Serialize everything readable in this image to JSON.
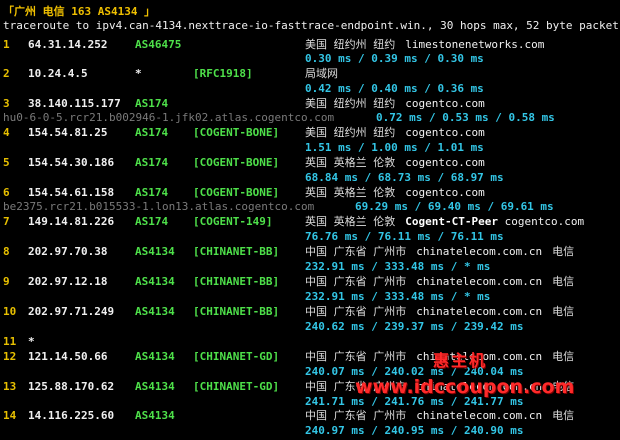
{
  "header": {
    "title": "「广州 电信 163 AS4134 」",
    "command": "traceroute to ipv4.can-4134.nexttrace-io-fasttrace-endpoint.win., 30 hops max, 52 byte packets"
  },
  "hops": [
    {
      "hop": "1",
      "ip": "64.31.14.252",
      "asn": "AS46475",
      "tag": "",
      "geo": "美国 纽约州 纽约",
      "host": "limestonenetworks.com",
      "lat": "0.30 ms / 0.39 ms / 0.30 ms",
      "rdns": ""
    },
    {
      "hop": "2",
      "ip": "10.24.4.5",
      "asn": "*",
      "tag": "[RFC1918]",
      "geo": "局域网",
      "host": "",
      "lat": "0.42 ms / 0.40 ms / 0.36 ms",
      "rdns": ""
    },
    {
      "hop": "3",
      "ip": "38.140.115.177",
      "asn": "AS174",
      "tag": "",
      "geo": "美国 纽约州 纽约",
      "host": "cogentco.com",
      "lat": "0.72 ms / 0.53 ms / 0.58 ms",
      "rdns": "hu0-6-0-5.rcr21.b002946-1.jfk02.atlas.cogentco.com"
    },
    {
      "hop": "4",
      "ip": "154.54.81.25",
      "asn": "AS174",
      "tag": "[COGENT-BONE]",
      "geo": "美国 纽约州 纽约",
      "host": "cogentco.com",
      "lat": "1.51 ms / 1.00 ms / 1.01 ms",
      "rdns": ""
    },
    {
      "hop": "5",
      "ip": "154.54.30.186",
      "asn": "AS174",
      "tag": "[COGENT-BONE]",
      "geo": "英国 英格兰 伦敦",
      "host": "cogentco.com",
      "lat": "68.84 ms / 68.73 ms / 68.97 ms",
      "rdns": ""
    },
    {
      "hop": "6",
      "ip": "154.54.61.158",
      "asn": "AS174",
      "tag": "[COGENT-BONE]",
      "geo": "英国 英格兰 伦敦",
      "host": "cogentco.com",
      "lat": "69.29 ms / 69.40 ms / 69.61 ms",
      "rdns": "be2375.rcr21.b015533-1.lon13.atlas.cogentco.com"
    },
    {
      "hop": "7",
      "ip": "149.14.81.226",
      "asn": "AS174",
      "tag": "[COGENT-149]",
      "geo": "英国 英格兰 伦敦",
      "host_bold": "Cogent-CT-Peer",
      "host": "cogentco.com",
      "lat": "76.76 ms / 76.11 ms / 76.11 ms",
      "rdns": ""
    },
    {
      "hop": "8",
      "ip": "202.97.70.38",
      "asn": "AS4134",
      "tag": "[CHINANET-BB]",
      "geo": "中国 广东省 广州市",
      "host": "chinatelecom.com.cn",
      "isp": "电信",
      "lat": "232.91 ms / 333.48 ms / * ms",
      "rdns": ""
    },
    {
      "hop": "9",
      "ip": "202.97.12.18",
      "asn": "AS4134",
      "tag": "[CHINANET-BB]",
      "geo": "中国 广东省 广州市",
      "host": "chinatelecom.com.cn",
      "isp": "电信",
      "lat": "232.91 ms / 333.48 ms / * ms",
      "rdns": ""
    },
    {
      "hop": "10",
      "ip": "202.97.71.249",
      "asn": "AS4134",
      "tag": "[CHINANET-BB]",
      "geo": "中国 广东省 广州市",
      "host": "chinatelecom.com.cn",
      "isp": "电信",
      "lat": "240.62 ms / 239.37 ms / 239.42 ms",
      "rdns": ""
    },
    {
      "hop": "11",
      "ip": "*",
      "asn": "",
      "tag": "",
      "geo": "",
      "host": "",
      "lat": "",
      "rdns": ""
    },
    {
      "hop": "12",
      "ip": "121.14.50.66",
      "asn": "AS4134",
      "tag": "[CHINANET-GD]",
      "geo": "中国 广东省 广州市",
      "host": "chinatelecom.com.cn",
      "isp": "电信",
      "lat": "240.07 ms / 240.02 ms / 240.04 ms",
      "rdns": ""
    },
    {
      "hop": "13",
      "ip": "125.88.170.62",
      "asn": "AS4134",
      "tag": "[CHINANET-GD]",
      "geo": "中国 广东省 广州市",
      "host": "chinatelecom.com.cn",
      "isp": "电信",
      "lat": "241.71 ms / 241.76 ms / 241.77 ms",
      "rdns": ""
    },
    {
      "hop": "14",
      "ip": "14.116.225.60",
      "asn": "AS4134",
      "tag": "",
      "geo": "中国 广东省 广州市",
      "host": "chinatelecom.com.cn",
      "isp": "电信",
      "lat": "240.97 ms / 240.95 ms / 240.90 ms",
      "rdns": ""
    }
  ],
  "watermark": {
    "line1": "惠主机",
    "line2": "www.idccoupon.com"
  },
  "colors": {
    "background": "#000000",
    "hop_number": "#e8c000",
    "asn": "#4ee04a",
    "latency": "#33c6e6",
    "rdns": "#7a7a7a",
    "watermark": "#ff2a2a"
  }
}
